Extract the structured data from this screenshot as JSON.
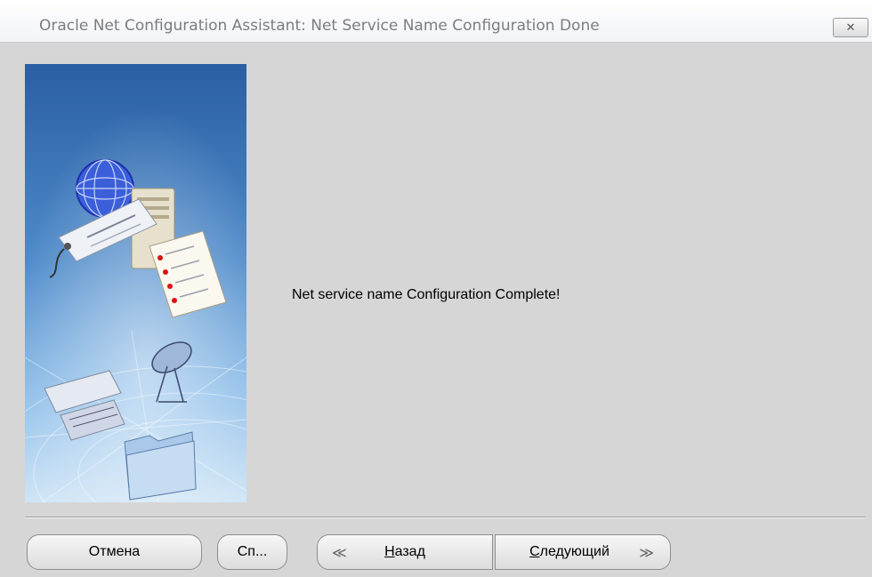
{
  "window": {
    "title": "Oracle Net Configuration Assistant: Net Service Name Configuration Done",
    "close_icon": "close-icon"
  },
  "content": {
    "message": "Net service name Configuration Complete!"
  },
  "buttons": {
    "cancel": "Отмена",
    "help": "Сп...",
    "back_mnemonic": "Н",
    "back_rest": "азад",
    "next_mnemonic": "С",
    "next_rest": "ледующий",
    "back_icon": "double-chevron-left-icon",
    "next_icon": "double-chevron-right-icon"
  },
  "colors": {
    "window_bg": "#d6d6d6",
    "panel_top": "#2a5fa3",
    "panel_bottom": "#cde2f5"
  }
}
